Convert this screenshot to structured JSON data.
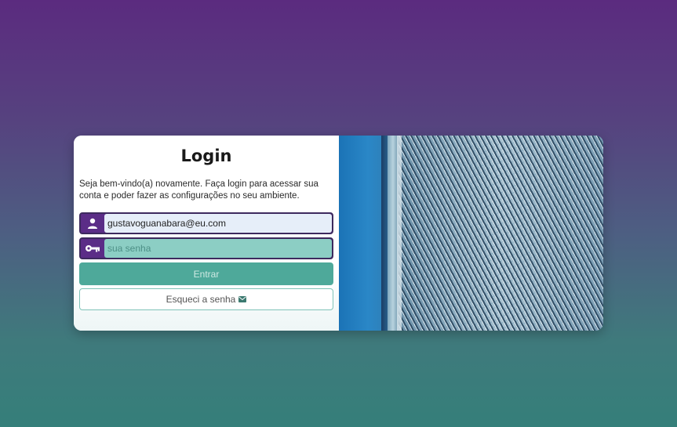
{
  "login": {
    "title": "Login",
    "intro": "Seja bem-vindo(a) novamente. Faça login para acessar sua conta e poder fazer as configurações no seu ambiente.",
    "email_value": "gustavoguanabara@eu.com",
    "password_placeholder": "sua senha",
    "submit_label": "Entrar",
    "forgot_label": "Esqueci a senha",
    "icons": {
      "user": "user-icon",
      "key": "key-icon",
      "mail": "mail-icon"
    },
    "colors": {
      "accent_purple": "#5b2d87",
      "accent_teal": "#4ea99a",
      "password_field_bg": "#8ccec4",
      "email_field_bg": "#e6eef9"
    }
  },
  "side_image": {
    "icon": "building-facade-image"
  }
}
